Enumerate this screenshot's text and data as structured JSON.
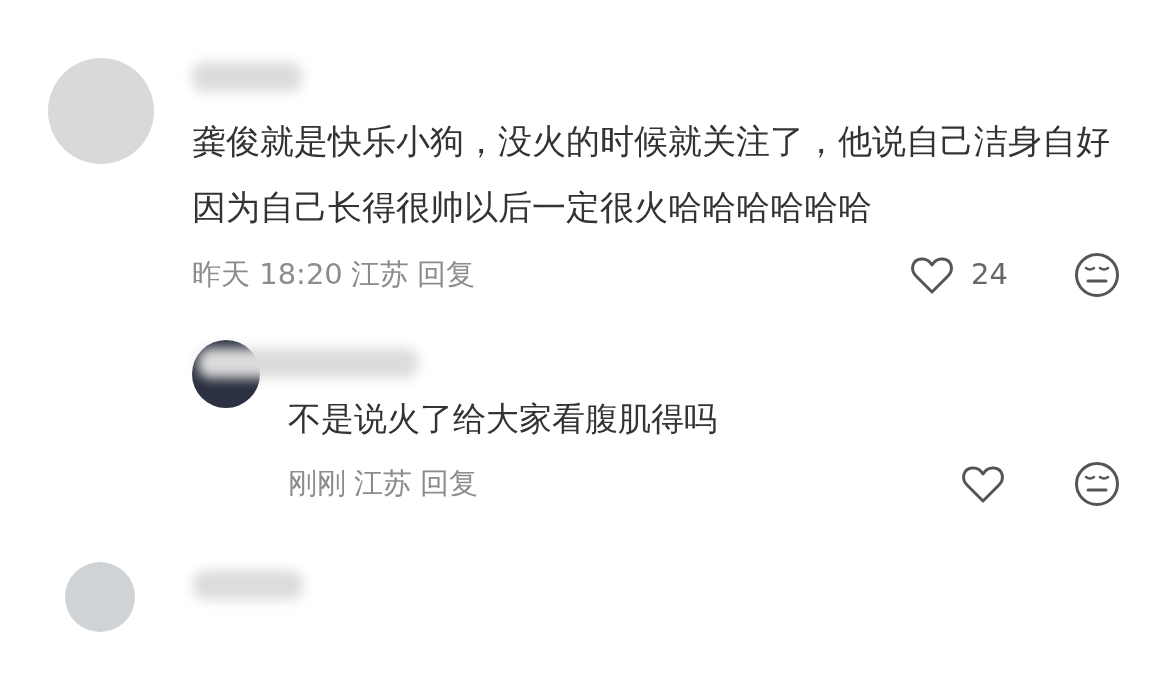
{
  "comments": [
    {
      "body": "龚俊就是快乐小狗，没火的时候就关注了，他说自己洁身自好因为自己长得很帅以后一定很火哈哈哈哈哈哈",
      "time": "昨天 18:20",
      "location": "江苏",
      "reply_label": "回复",
      "likes": "24",
      "liked": false,
      "replies": [
        {
          "body": "不是说火了给大家看腹肌得吗",
          "time": "刚刚",
          "location": "江苏",
          "reply_label": "回复",
          "liked": false
        }
      ]
    }
  ]
}
